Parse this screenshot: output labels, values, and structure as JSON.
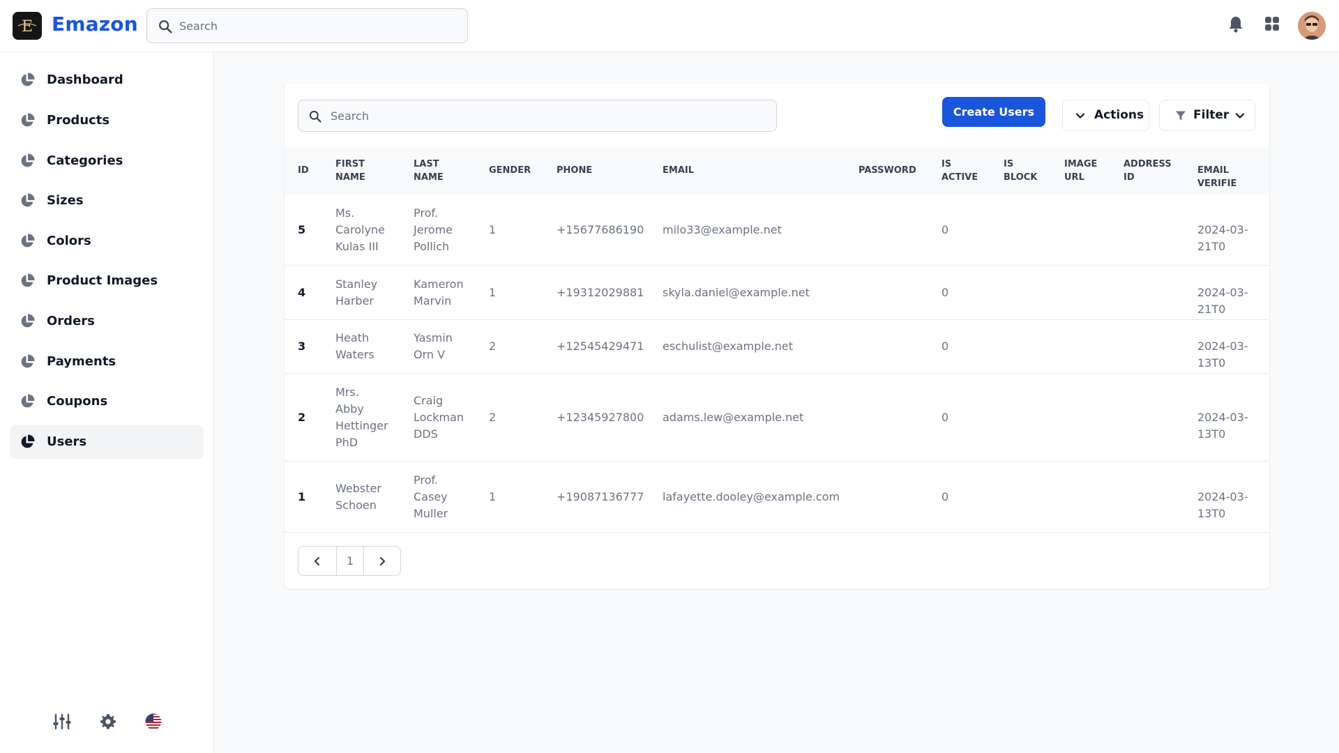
{
  "app": {
    "brand": "Emazon",
    "logo_letter": "E"
  },
  "topbar": {
    "search_placeholder": "Search"
  },
  "sidebar": {
    "items": [
      {
        "label": "Dashboard"
      },
      {
        "label": "Products"
      },
      {
        "label": "Categories"
      },
      {
        "label": "Sizes"
      },
      {
        "label": "Colors"
      },
      {
        "label": "Product Images"
      },
      {
        "label": "Orders"
      },
      {
        "label": "Payments"
      },
      {
        "label": "Coupons"
      },
      {
        "label": "Users",
        "active": true
      }
    ]
  },
  "toolbar": {
    "search_placeholder": "Search",
    "create_label": "Create Users",
    "actions_label": "Actions",
    "filter_label": "Filter"
  },
  "table": {
    "columns": [
      "ID",
      "FIRST\nNAME",
      "LAST\nNAME",
      "GENDER",
      "PHONE",
      "EMAIL",
      "PASSWORD",
      "IS\nACTIVE",
      "IS\nBLOCK",
      "IMAGE\nURL",
      "ADDRESS\nID",
      "EMAIL VERIFIE"
    ],
    "rows": [
      {
        "id": "5",
        "first_name": "Ms.\nCarolyne\nKulas III",
        "last_name": "Prof.\nJerome\nPollich",
        "gender": "1",
        "phone": "+15677686190",
        "email": "milo33@example.net",
        "is_active": "0",
        "email_verified": "2024-03-21T0"
      },
      {
        "id": "4",
        "first_name": "Stanley\nHarber",
        "last_name": "Kameron\nMarvin",
        "gender": "1",
        "phone": "+19312029881",
        "email": "skyla.daniel@example.net",
        "is_active": "0",
        "email_verified": "2024-03-21T0"
      },
      {
        "id": "3",
        "first_name": "Heath\nWaters",
        "last_name": "Yasmin\nOrn V",
        "gender": "2",
        "phone": "+12545429471",
        "email": "eschulist@example.net",
        "is_active": "0",
        "email_verified": "2024-03-13T0"
      },
      {
        "id": "2",
        "first_name": "Mrs.\nAbby\nHettinger\nPhD",
        "last_name": "Craig\nLockman\nDDS",
        "gender": "2",
        "phone": "+12345927800",
        "email": "adams.lew@example.net",
        "is_active": "0",
        "email_verified": "2024-03-13T0"
      },
      {
        "id": "1",
        "first_name": "Webster\nSchoen",
        "last_name": "Prof.\nCasey\nMuller",
        "gender": "1",
        "phone": "+19087136777",
        "email": "lafayette.dooley@example.com",
        "is_active": "0",
        "email_verified": "2024-03-13T0"
      }
    ]
  },
  "pagination": {
    "current_page": "1"
  },
  "colors": {
    "brand": "#1a56db",
    "text": "#111827",
    "muted": "#6b7280",
    "border": "#e5e7eb"
  },
  "icons": {
    "nav": "pie-chart-icon",
    "top": [
      "bell-icon",
      "apps-grid-icon"
    ],
    "footer": [
      "sliders-icon",
      "gear-icon",
      "us-flag-icon"
    ]
  }
}
